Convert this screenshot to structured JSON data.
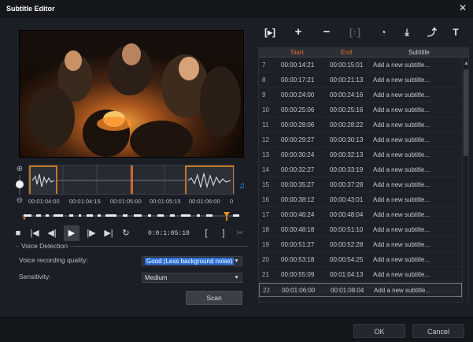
{
  "window": {
    "title": "Subtitle Editor",
    "close_glyph": "✕"
  },
  "playback": {
    "timeline_labels": [
      "00:01:04:00",
      "00:01:04:15",
      "00:01:05:00",
      "00:01:05:15",
      "00:01:06:00",
      "0"
    ],
    "timecode": "0:0:1:05:10"
  },
  "voice_detection": {
    "legend": "Voice Detection",
    "quality_label": "Voice recording quality:",
    "quality_value": "Good (Less background noise)",
    "sensitivity_label": "Sensitivity:",
    "sensitivity_value": "Medium",
    "scan_label": "Scan"
  },
  "table": {
    "columns": {
      "start": "Start",
      "end": "End",
      "subtitle": "Subtitle"
    },
    "rows": [
      {
        "n": "7",
        "start": "00:00:14:21",
        "end": "00:00:15:01",
        "text": "Add a new subtitle..."
      },
      {
        "n": "8",
        "start": "00:00:17:21",
        "end": "00:00:21:13",
        "text": "Add a new subtitle..."
      },
      {
        "n": "9",
        "start": "00:00:24:00",
        "end": "00:00:24:16",
        "text": "Add a new subtitle..."
      },
      {
        "n": "10",
        "start": "00:00:25:06",
        "end": "00:00:25:16",
        "text": "Add a new subtitle..."
      },
      {
        "n": "11",
        "start": "00:00:28:06",
        "end": "00:00:28:22",
        "text": "Add a new subtitle..."
      },
      {
        "n": "12",
        "start": "00:00:29:27",
        "end": "00:00:30:13",
        "text": "Add a new subtitle..."
      },
      {
        "n": "13",
        "start": "00:00:30:24",
        "end": "00:00:32:13",
        "text": "Add a new subtitle..."
      },
      {
        "n": "14",
        "start": "00:00:32:27",
        "end": "00:00:33:19",
        "text": "Add a new subtitle..."
      },
      {
        "n": "15",
        "start": "00:00:35:27",
        "end": "00:00:37:28",
        "text": "Add a new subtitle..."
      },
      {
        "n": "16",
        "start": "00:00:38:12",
        "end": "00:00:43:01",
        "text": "Add a new subtitle..."
      },
      {
        "n": "17",
        "start": "00:00:46:24",
        "end": "00:00:48:04",
        "text": "Add a new subtitle..."
      },
      {
        "n": "18",
        "start": "00:00:48:18",
        "end": "00:00:51:10",
        "text": "Add a new subtitle..."
      },
      {
        "n": "19",
        "start": "00:00:51:27",
        "end": "00:00:52:28",
        "text": "Add a new subtitle..."
      },
      {
        "n": "20",
        "start": "00:00:53:18",
        "end": "00:00:54:25",
        "text": "Add a new subtitle..."
      },
      {
        "n": "21",
        "start": "00:00:55:09",
        "end": "00:01:04:13",
        "text": "Add a new subtitle..."
      },
      {
        "n": "22",
        "start": "00:01:06:00",
        "end": "00:01:08:04",
        "text": "Add a new subtitle..."
      }
    ]
  },
  "footer": {
    "ok_label": "OK",
    "cancel_label": "Cancel"
  },
  "colors": {
    "accent_orange": "#f0901e",
    "header_orange": "#e26b2e",
    "selection_blue": "#2a6fd6",
    "audio_blue": "#1ea0ff"
  }
}
